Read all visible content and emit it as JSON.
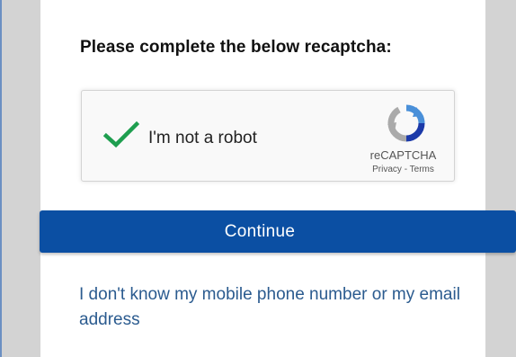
{
  "heading": "Please complete the below recaptcha:",
  "recaptcha": {
    "checkbox_label": "I'm not a robot",
    "checked": true,
    "brand": "reCAPTCHA",
    "privacy_link": "Privacy",
    "separator": " - ",
    "terms_link": "Terms",
    "check_color": "#1e9e4f"
  },
  "actions": {
    "continue_label": "Continue",
    "button_color": "#0b4fa3"
  },
  "help_link": "I don't know my mobile phone number or my email address"
}
